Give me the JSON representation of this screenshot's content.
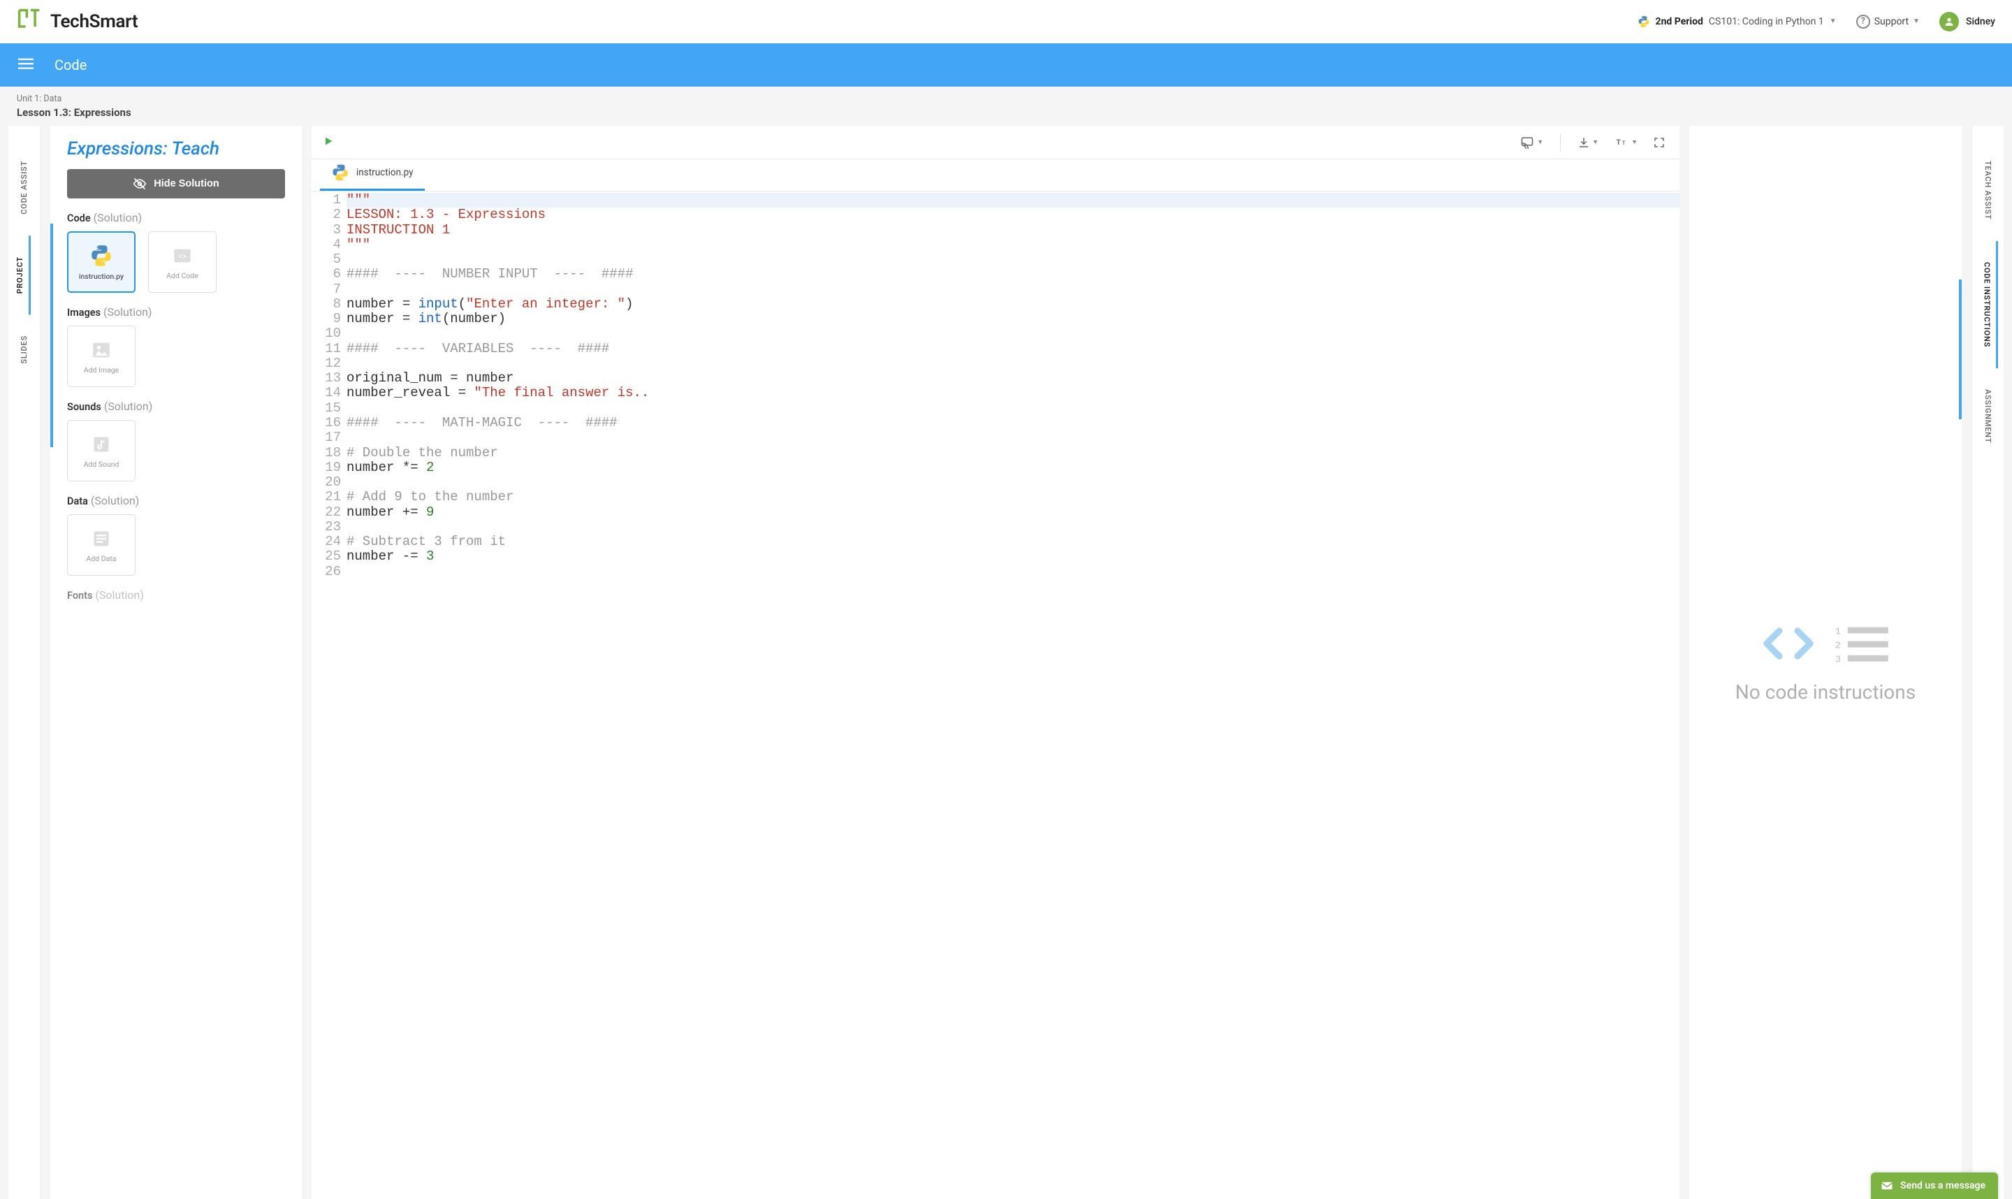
{
  "header": {
    "brand": "TechSmart",
    "period": "2nd Period",
    "course": "CS101: Coding in Python 1",
    "support": "Support",
    "user": "Sidney"
  },
  "bluebar": {
    "title": "Code"
  },
  "crumb": {
    "unit": "Unit 1: Data",
    "lesson": "Lesson 1.3: Expressions"
  },
  "left_rail": [
    "CODE ASSIST",
    "PROJECT",
    "SLIDES"
  ],
  "right_rail": [
    "TEACH ASSIST",
    "CODE INSTRUCTIONS",
    "ASSIGNMENT"
  ],
  "project": {
    "title": "Expressions: Teach",
    "hide_solution": "Hide Solution",
    "sections": {
      "code": {
        "label": "Code",
        "sub": "(Solution)",
        "items": [
          {
            "name": "instruction.py",
            "selected": true
          },
          {
            "name": "Add Code",
            "selected": false
          }
        ]
      },
      "images": {
        "label": "Images",
        "sub": "(Solution)",
        "items": [
          {
            "name": "Add Image"
          }
        ]
      },
      "sounds": {
        "label": "Sounds",
        "sub": "(Solution)",
        "items": [
          {
            "name": "Add Sound"
          }
        ]
      },
      "data": {
        "label": "Data",
        "sub": "(Solution)",
        "items": [
          {
            "name": "Add Data"
          }
        ]
      },
      "fonts": {
        "label": "Fonts",
        "sub": "(Solution)"
      }
    }
  },
  "editor": {
    "filename": "instruction.py",
    "lines": [
      {
        "n": 1,
        "html": "<span class='line1-hl'><span class='tok-str'>\"\"\"</span></span>"
      },
      {
        "n": 2,
        "html": "<span class='tok-str'>LESSON: 1.3 - Expressions</span>"
      },
      {
        "n": 3,
        "html": "<span class='tok-str'>INSTRUCTION 1</span>"
      },
      {
        "n": 4,
        "html": "<span class='tok-str'>\"\"\"</span>"
      },
      {
        "n": 5,
        "html": ""
      },
      {
        "n": 6,
        "html": "<span class='tok-cmt'>####  ----  NUMBER INPUT  ----  ####</span>"
      },
      {
        "n": 7,
        "html": ""
      },
      {
        "n": 8,
        "html": "number = <span class='tok-kw'>input</span>(<span class='tok-str'>\"Enter an integer: \"</span>)"
      },
      {
        "n": 9,
        "html": "number = <span class='tok-kw'>int</span>(number)"
      },
      {
        "n": 10,
        "html": ""
      },
      {
        "n": 11,
        "html": "<span class='tok-cmt'>####  ----  VARIABLES  ----  ####</span>"
      },
      {
        "n": 12,
        "html": ""
      },
      {
        "n": 13,
        "html": "original_num = number"
      },
      {
        "n": 14,
        "html": "number_reveal = <span class='tok-str'>\"The final answer is..</span>"
      },
      {
        "n": 15,
        "html": ""
      },
      {
        "n": 16,
        "html": "<span class='tok-cmt'>####  ----  MATH-MAGIC  ----  ####</span>"
      },
      {
        "n": 17,
        "html": ""
      },
      {
        "n": 18,
        "html": "<span class='tok-cmt'># Double the number</span>"
      },
      {
        "n": 19,
        "html": "number *= <span class='tok-num'>2</span>"
      },
      {
        "n": 20,
        "html": ""
      },
      {
        "n": 21,
        "html": "<span class='tok-cmt'># Add 9 to the number</span>"
      },
      {
        "n": 22,
        "html": "number += <span class='tok-num'>9</span>"
      },
      {
        "n": 23,
        "html": ""
      },
      {
        "n": 24,
        "html": "<span class='tok-cmt'># Subtract 3 from it</span>"
      },
      {
        "n": 25,
        "html": "number -= <span class='tok-num'>3</span>"
      },
      {
        "n": 26,
        "html": ""
      }
    ]
  },
  "instructions": {
    "empty_msg": "No code instructions"
  },
  "chat": {
    "label": "Send us a message"
  }
}
